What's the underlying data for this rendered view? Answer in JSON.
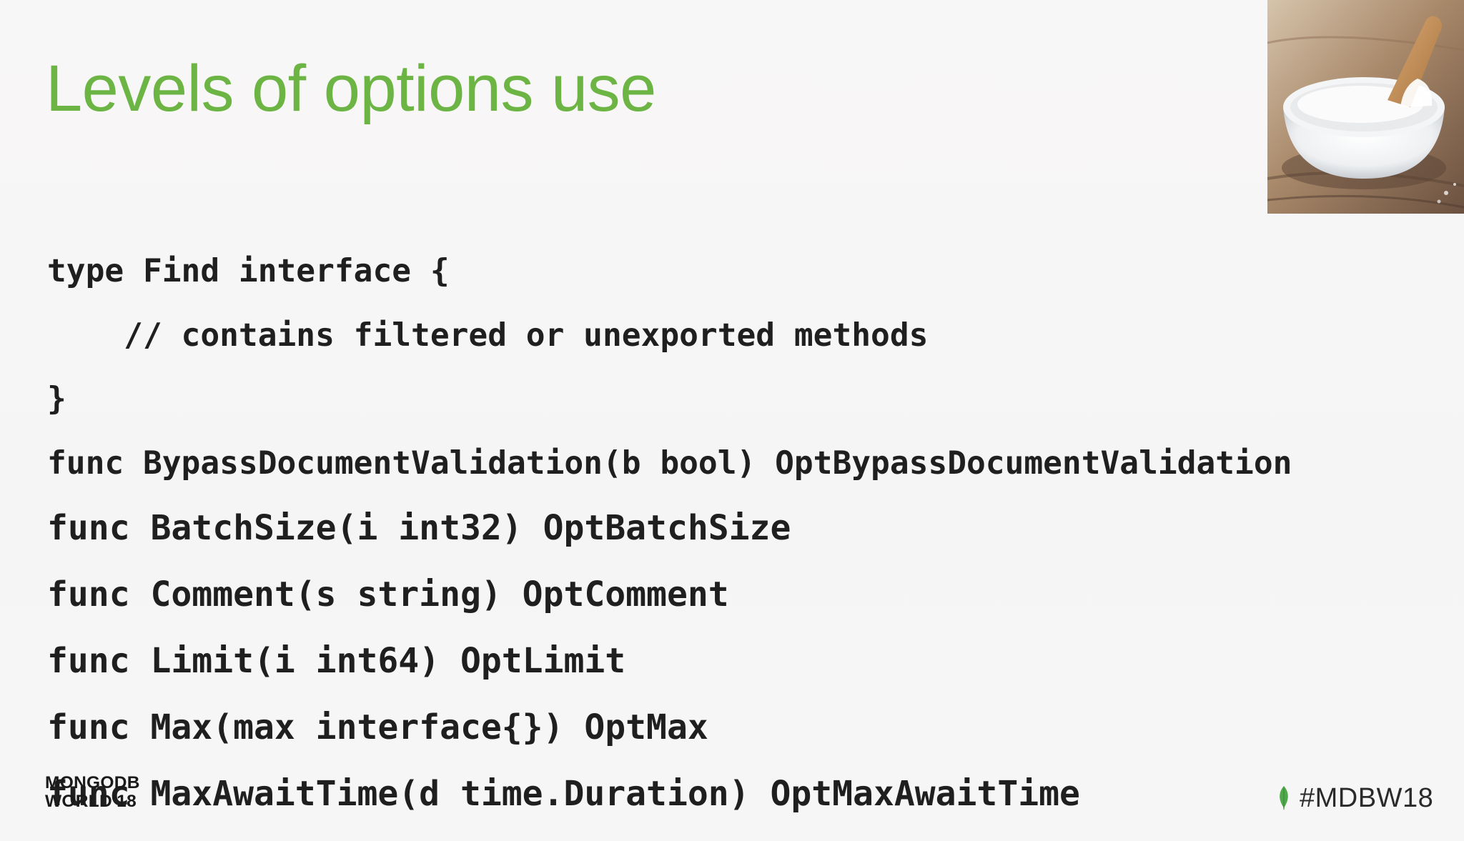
{
  "slide": {
    "title": "Levels of options use",
    "code_lines": [
      "type Find interface {",
      "    // contains filtered or unexported methods",
      "}",
      "func BypassDocumentValidation(b bool) OptBypassDocumentValidation",
      "func BatchSize(i int32) OptBatchSize",
      "func Comment(s string) OptComment",
      "func Limit(i int64) OptLimit",
      "func Max(max interface{}) OptMax",
      "func MaxAwaitTime(d time.Duration) OptMaxAwaitTime"
    ],
    "photo_icon": "salt-bowl-photo",
    "logo": {
      "line1": "MONGODB",
      "line2": "WORLD'18"
    },
    "hashtag": {
      "icon": "mongodb-leaf-icon",
      "text": "#MDBW18"
    },
    "colors": {
      "title": "#6cb545",
      "leaf": "#4fa94a",
      "code": "#1f1f1f",
      "background": "#f7f6f6"
    }
  }
}
